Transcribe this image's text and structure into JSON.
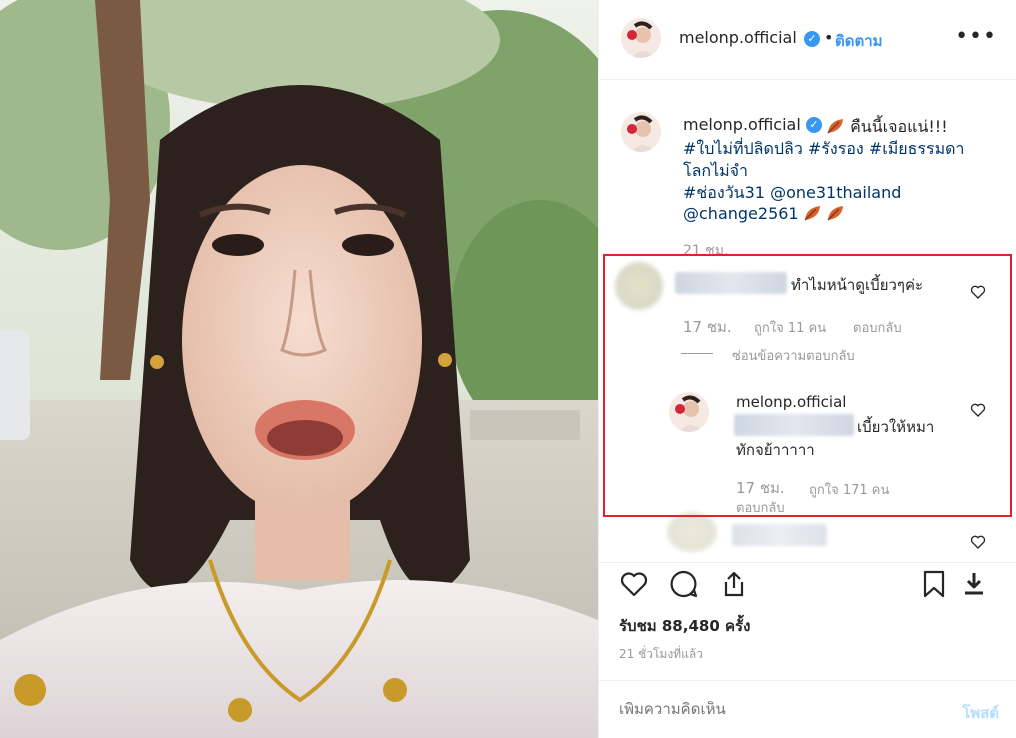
{
  "post": {
    "username": "melonp.official",
    "dot": "•",
    "follow_label": "ติดตาม",
    "more_label": "•••"
  },
  "caption": {
    "username": "melonp.official",
    "line1": "คืนนี้เจอแน่!!!",
    "line2": "#ใบไม่ที่ปลิดปลิว #รังรอง #เมียธรรมดา",
    "line3": "โลกไม่จำ",
    "line4a": "#ช่องวัน31",
    "line4b": "@one31thailand",
    "line5": "@change2561",
    "time": "21 ชม."
  },
  "comment1": {
    "text": "ทำไมหน้าดูเบี้ยวๆค่ะ",
    "time": "17 ชม.",
    "likes": "ถูกใจ 11 คน",
    "reply_label": "ตอบกลับ",
    "hide_replies": "ซ่อนข้อความตอบกลับ"
  },
  "reply1": {
    "username": "melonp.official",
    "text1": "เบี้ยวให้หมา",
    "text2": "ทักจย้าาาาา",
    "time": "17 ชม.",
    "likes": "ถูกใจ 171 คน",
    "reply_label": "ตอบกลับ"
  },
  "stats": {
    "views": "รับชม 88,480 ครั้ง",
    "posted": "21 ชั่วโมงที่แล้ว"
  },
  "comment_box": {
    "placeholder": "เพิ่มความคิดเห็น",
    "post_label": "โพสต์"
  },
  "icons": {
    "verified": "check-badge-icon",
    "like": "heart-icon",
    "comment": "speech-bubble-icon",
    "share": "share-icon",
    "save": "bookmark-icon",
    "download": "download-icon"
  },
  "colors": {
    "link": "#3897f0",
    "hashtag": "#003569",
    "highlight_box": "#e0212e",
    "muted": "#999999"
  }
}
